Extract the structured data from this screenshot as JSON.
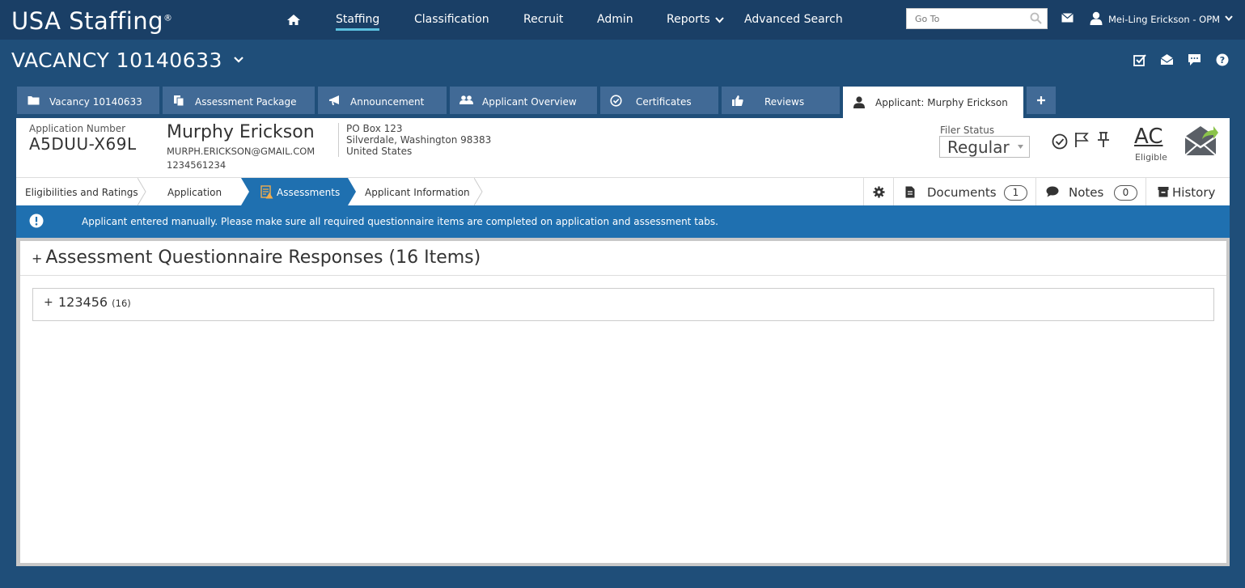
{
  "topnav": {
    "logo": "USA Staffing",
    "logo_mark": "®",
    "links": [
      "Staffing",
      "Classification",
      "Recruit",
      "Admin",
      "Reports",
      "Advanced Search"
    ],
    "goto_placeholder": "Go To",
    "user": "Mei-Ling Erickson - OPM"
  },
  "vacancy": {
    "title": "VACANCY 10140633"
  },
  "tabs": [
    {
      "label": "Vacancy 10140633",
      "icon": "folder-icon"
    },
    {
      "label": "Assessment Package",
      "icon": "documents-icon"
    },
    {
      "label": "Announcement",
      "icon": "megaphone-icon"
    },
    {
      "label": "Applicant Overview",
      "icon": "users-icon"
    },
    {
      "label": "Certificates",
      "icon": "check-circle-icon"
    },
    {
      "label": "Reviews",
      "icon": "thumbs-up-icon"
    },
    {
      "label": "Applicant: Murphy Erickson",
      "icon": "user-icon"
    },
    {
      "label": "+",
      "icon": "plus-icon"
    }
  ],
  "applicant": {
    "app_number_label": "Application Number",
    "app_number": "A5DUU-X69L",
    "name": "Murphy Erickson",
    "email": "MURPH.ERICKSON@GMAIL.COM",
    "phone": "1234561234",
    "address": [
      "PO Box 123",
      "Silverdale, Washington 98383",
      "United States"
    ],
    "filer_status_label": "Filer Status",
    "filer_status": "Regular",
    "eligibility_code": "AC",
    "eligibility_label": "Eligible"
  },
  "subtabs": [
    "Eligibilities and Ratings",
    "Application",
    "Assessments",
    "Applicant Information"
  ],
  "actions": {
    "documents_label": "Documents",
    "documents_count": "1",
    "notes_label": "Notes",
    "notes_count": "0",
    "history_label": "History"
  },
  "alert": "Applicant entered manually. Please make sure all required questionnaire items are completed on application and assessment tabs.",
  "section": {
    "title": "Assessment Questionnaire Responses (16 Items)",
    "item_name": "123456",
    "item_count": "(16)"
  },
  "colors": {
    "nav_bg": "#1a3f66",
    "page_bg": "#1f4e79",
    "tab_bg": "#416a96",
    "alert_bg": "#1f70b0",
    "active_subtab": "#1f70b0",
    "active_underline": "#5bc0de"
  }
}
